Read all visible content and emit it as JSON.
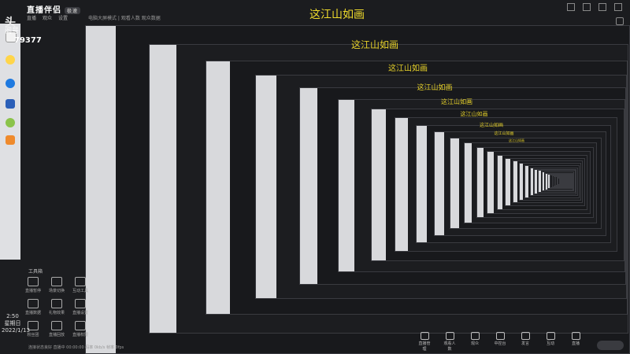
{
  "app": {
    "logo_text": "直播伴侣",
    "logo_badge": "极速",
    "title": "这江山如画",
    "tabs": [
      "直播",
      "观众",
      "设置"
    ],
    "room_info": "电脑大屏模式  | 观看人数  观众数据",
    "watermark_line1": "头",
    "watermark_line2": "阅号",
    "watermark_number": "79377"
  },
  "recursive_titles": [
    "这江山如画",
    "这江山如画",
    "这江山如画",
    "这江山如画",
    "这江山如画",
    "这江山如画",
    "这江山如画",
    "这江山如画"
  ],
  "panel": {
    "header": "工具箱",
    "tools": [
      {
        "label": "直播暂停",
        "icon": "pause-icon"
      },
      {
        "label": "场景切换",
        "icon": "scene-icon"
      },
      {
        "label": "互动工具",
        "icon": "interact-icon"
      },
      {
        "label": "直播数据",
        "icon": "data-icon"
      },
      {
        "label": "礼物效果",
        "icon": "gift-icon"
      },
      {
        "label": "直播设置",
        "icon": "settings-icon"
      },
      {
        "label": "粉丝团",
        "icon": "fans-icon"
      },
      {
        "label": "直播回放",
        "icon": "replay-icon"
      },
      {
        "label": "直播权限",
        "icon": "permission-icon"
      }
    ]
  },
  "clock": {
    "time": "2:50",
    "weekday": "星期日",
    "date": "2022/1/13"
  },
  "bottom_bar": {
    "status_text": "连接状态良好  直播中 00:00:00  码率 0kb/s  帧率 0fps",
    "tools": [
      "直播管理",
      "观看人数",
      "观众",
      "中控台",
      "发言",
      "互动",
      "直播"
    ]
  }
}
